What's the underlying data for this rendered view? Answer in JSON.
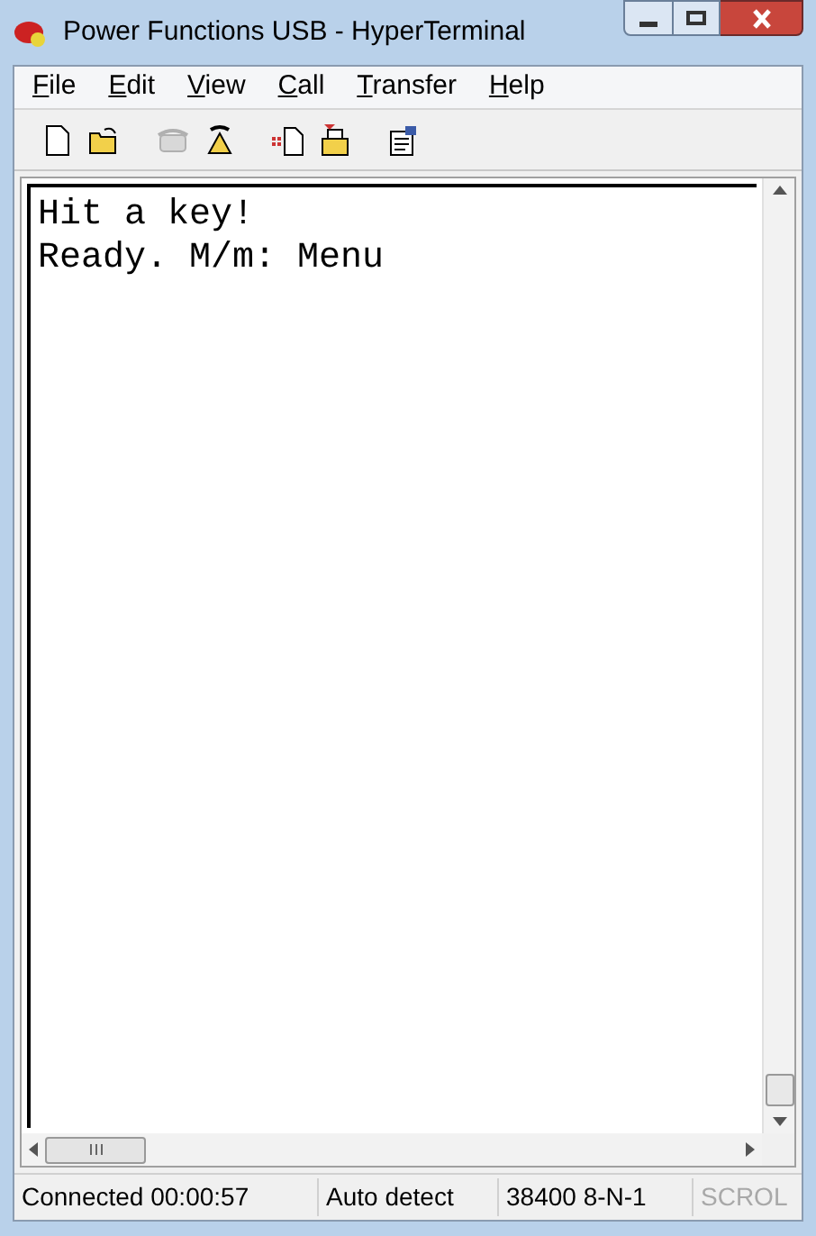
{
  "window": {
    "title": "Power Functions USB - HyperTerminal"
  },
  "menu": [
    {
      "label": "File"
    },
    {
      "label": "Edit"
    },
    {
      "label": "View"
    },
    {
      "label": "Call"
    },
    {
      "label": "Transfer"
    },
    {
      "label": "Help"
    }
  ],
  "toolbar": [
    {
      "disabled": false
    },
    {
      "disabled": false
    },
    {
      "disabled": true
    },
    {
      "disabled": false
    },
    {
      "disabled": false
    },
    {
      "disabled": false
    },
    {
      "disabled": false
    }
  ],
  "terminal": {
    "lines": [
      "Hit a key!",
      "Ready. M/m: Menu"
    ]
  },
  "status_bar": [
    {
      "text": "Connected 00:00:57",
      "disabled": false
    },
    {
      "text": "Auto detect",
      "disabled": false
    },
    {
      "text": "38400 8-N-1",
      "disabled": false
    },
    {
      "text": "SCROL",
      "disabled": true
    }
  ]
}
